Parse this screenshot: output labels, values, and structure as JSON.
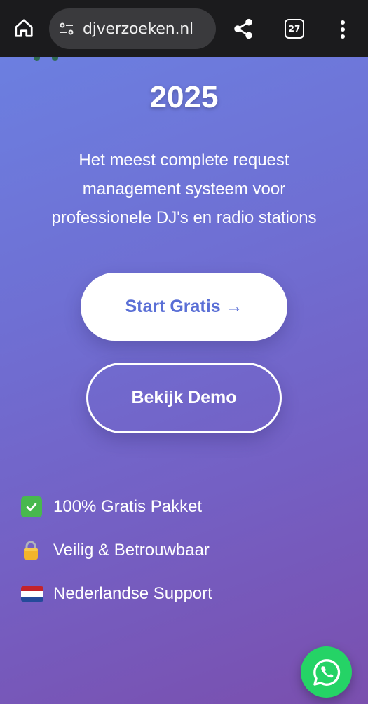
{
  "browser": {
    "url": "djverzoeken.nl",
    "tab_count": "27",
    "icons": [
      "home-icon",
      "site-info-icon",
      "share-icon",
      "tabs-icon",
      "more-vert-icon"
    ]
  },
  "hero": {
    "year": "2025",
    "tagline_lines": [
      "Het meest complete request",
      "management systeem voor",
      "professionele DJ's en radio stations"
    ],
    "start_button": "Start Gratis →",
    "demo_button": "Bekijk Demo",
    "features": [
      {
        "icon": "check-mark-icon",
        "label": "100% Gratis Pakket"
      },
      {
        "icon": "lock-icon",
        "label": "Veilig & Betrouwbaar"
      },
      {
        "icon": "netherlands-flag-icon",
        "label": "Nederlandse Support"
      }
    ]
  },
  "colors": {
    "gradient_start": "#6c7fe0",
    "gradient_end": "#7a4fae",
    "start_button_text": "#5a6fd6",
    "whatsapp_green": "#25d366",
    "browser_bar": "#1b1b1d"
  },
  "floating": {
    "icon": "whatsapp-icon"
  }
}
